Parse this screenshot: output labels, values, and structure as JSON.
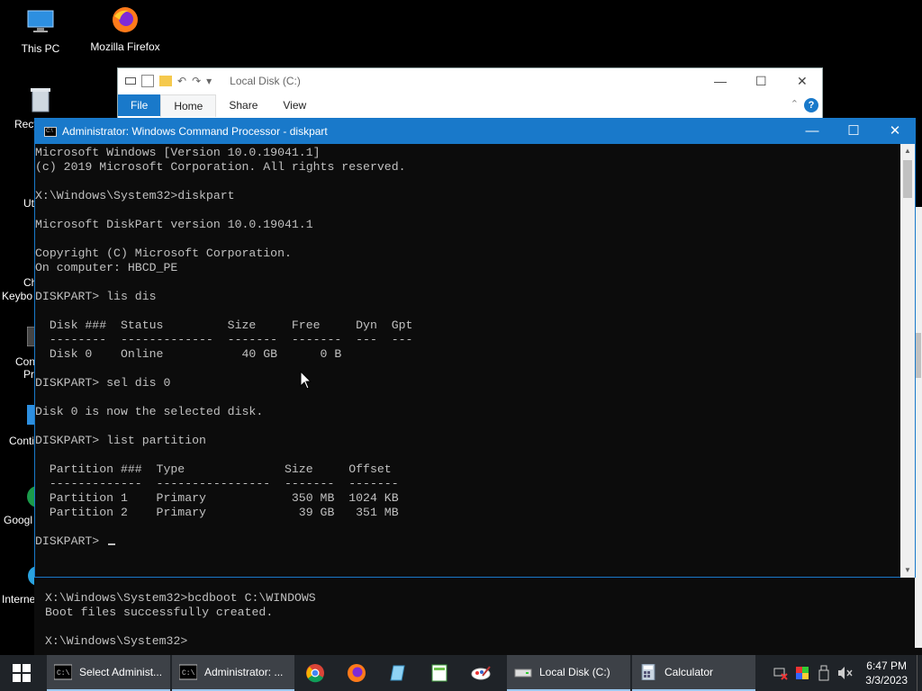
{
  "desktop": {
    "icons": [
      {
        "label": "This PC"
      },
      {
        "label": "Mozilla Firefox"
      }
    ],
    "clipped_labels": [
      "Recy",
      "Ut",
      "Ch",
      "Keybo",
      "Con",
      "Pr",
      "Conti",
      "Googl",
      "Internet E"
    ]
  },
  "explorer": {
    "title": "Local Disk (C:)",
    "tabs": [
      "File",
      "Home",
      "Share",
      "View"
    ]
  },
  "cmd": {
    "title": "Administrator: Windows Command Processor - diskpart",
    "lines": [
      "Microsoft Windows [Version 10.0.19041.1]",
      "(c) 2019 Microsoft Corporation. All rights reserved.",
      "",
      "X:\\Windows\\System32>diskpart",
      "",
      "Microsoft DiskPart version 10.0.19041.1",
      "",
      "Copyright (C) Microsoft Corporation.",
      "On computer: HBCD_PE",
      "",
      "DISKPART> lis dis",
      "",
      "  Disk ###  Status         Size     Free     Dyn  Gpt",
      "  --------  -------------  -------  -------  ---  ---",
      "  Disk 0    Online           40 GB      0 B",
      "",
      "DISKPART> sel dis 0",
      "",
      "Disk 0 is now the selected disk.",
      "",
      "DISKPART> list partition",
      "",
      "  Partition ###  Type              Size     Offset",
      "  -------------  ----------------  -------  -------",
      "  Partition 1    Primary            350 MB  1024 KB",
      "  Partition 2    Primary             39 GB   351 MB",
      "",
      "DISKPART> "
    ]
  },
  "background_console": {
    "lines": [
      "X:\\Windows\\System32>bcdboot C:\\WINDOWS",
      "Boot files successfully created.",
      "",
      "X:\\Windows\\System32>"
    ]
  },
  "taskbar": {
    "buttons": [
      {
        "label": "Select Administ..."
      },
      {
        "label": "Administrator: ..."
      },
      {
        "label": "Local Disk (C:)"
      },
      {
        "label": "Calculator"
      }
    ],
    "time": "6:47 PM",
    "date": "3/3/2023"
  },
  "colors": {
    "accent": "#1979ca",
    "console_bg": "#0c0c0c",
    "console_fg": "#c0c0c0"
  }
}
